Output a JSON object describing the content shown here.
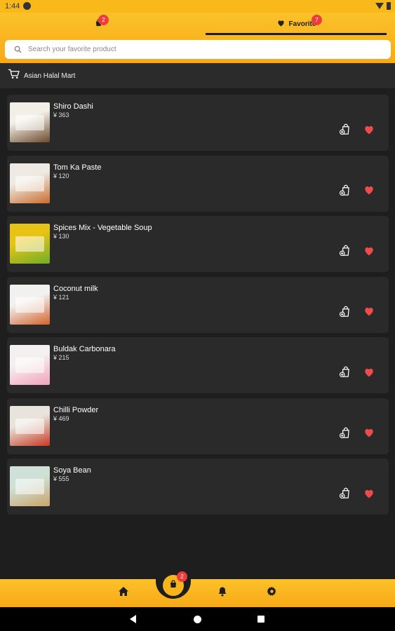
{
  "status_bar": {
    "time": "1:44"
  },
  "tabs": {
    "bag": {
      "badge": "2"
    },
    "favorite": {
      "label": "Favorite",
      "badge": "7"
    }
  },
  "search": {
    "placeholder": "Search your favorite product"
  },
  "store": {
    "name": "Asian Halal Mart"
  },
  "products": [
    {
      "name": "Shiro Dashi",
      "price": "¥ 363",
      "thumb_colors": [
        "#f2efe6",
        "#6b4a2b"
      ]
    },
    {
      "name": "Tom Ka Paste",
      "price": "¥ 120",
      "thumb_colors": [
        "#eeeae3",
        "#c96c2c"
      ]
    },
    {
      "name": "Spices Mix - Vegetable Soup",
      "price": "¥ 130",
      "thumb_colors": [
        "#e6c315",
        "#6fae2a"
      ]
    },
    {
      "name": "Coconut milk",
      "price": "¥ 121",
      "thumb_colors": [
        "#f1f1ef",
        "#d4632b"
      ]
    },
    {
      "name": "Buldak Carbonara",
      "price": "¥ 215",
      "thumb_colors": [
        "#f5f0f0",
        "#f2a3b8"
      ]
    },
    {
      "name": "Chilli Powder",
      "price": "¥ 469",
      "thumb_colors": [
        "#e8e4dc",
        "#c83a22"
      ]
    },
    {
      "name": "Soya Bean",
      "price": "¥ 555",
      "thumb_colors": [
        "#cfe1d6",
        "#c9a46a"
      ]
    }
  ],
  "bottom_nav": {
    "cart_badge": "2"
  },
  "colors": {
    "accent": "#f9b91b",
    "badge": "#ef3b3b",
    "heart": "#ef4b4b",
    "card_bg": "#2a2a2a",
    "page_bg": "#1e1e1e"
  }
}
